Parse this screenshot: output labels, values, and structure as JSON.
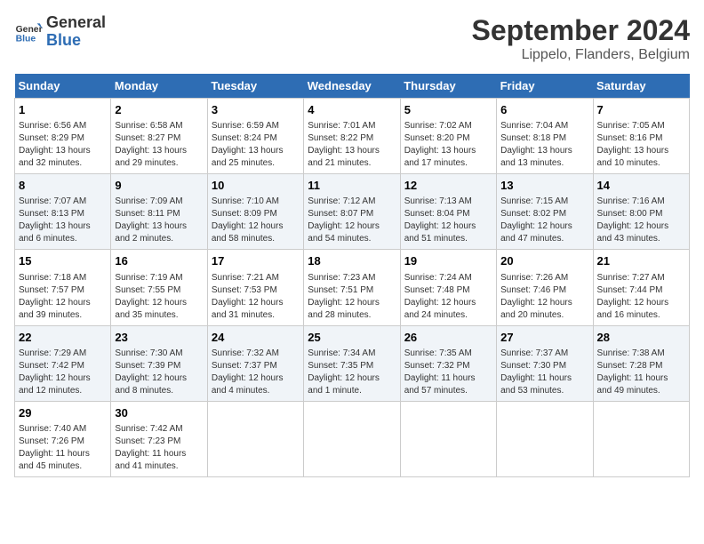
{
  "header": {
    "logo_line1": "General",
    "logo_line2": "Blue",
    "main_title": "September 2024",
    "subtitle": "Lippelo, Flanders, Belgium"
  },
  "days_of_week": [
    "Sunday",
    "Monday",
    "Tuesday",
    "Wednesday",
    "Thursday",
    "Friday",
    "Saturday"
  ],
  "weeks": [
    [
      {
        "day": "1",
        "info": "Sunrise: 6:56 AM\nSunset: 8:29 PM\nDaylight: 13 hours\nand 32 minutes."
      },
      {
        "day": "2",
        "info": "Sunrise: 6:58 AM\nSunset: 8:27 PM\nDaylight: 13 hours\nand 29 minutes."
      },
      {
        "day": "3",
        "info": "Sunrise: 6:59 AM\nSunset: 8:24 PM\nDaylight: 13 hours\nand 25 minutes."
      },
      {
        "day": "4",
        "info": "Sunrise: 7:01 AM\nSunset: 8:22 PM\nDaylight: 13 hours\nand 21 minutes."
      },
      {
        "day": "5",
        "info": "Sunrise: 7:02 AM\nSunset: 8:20 PM\nDaylight: 13 hours\nand 17 minutes."
      },
      {
        "day": "6",
        "info": "Sunrise: 7:04 AM\nSunset: 8:18 PM\nDaylight: 13 hours\nand 13 minutes."
      },
      {
        "day": "7",
        "info": "Sunrise: 7:05 AM\nSunset: 8:16 PM\nDaylight: 13 hours\nand 10 minutes."
      }
    ],
    [
      {
        "day": "8",
        "info": "Sunrise: 7:07 AM\nSunset: 8:13 PM\nDaylight: 13 hours\nand 6 minutes."
      },
      {
        "day": "9",
        "info": "Sunrise: 7:09 AM\nSunset: 8:11 PM\nDaylight: 13 hours\nand 2 minutes."
      },
      {
        "day": "10",
        "info": "Sunrise: 7:10 AM\nSunset: 8:09 PM\nDaylight: 12 hours\nand 58 minutes."
      },
      {
        "day": "11",
        "info": "Sunrise: 7:12 AM\nSunset: 8:07 PM\nDaylight: 12 hours\nand 54 minutes."
      },
      {
        "day": "12",
        "info": "Sunrise: 7:13 AM\nSunset: 8:04 PM\nDaylight: 12 hours\nand 51 minutes."
      },
      {
        "day": "13",
        "info": "Sunrise: 7:15 AM\nSunset: 8:02 PM\nDaylight: 12 hours\nand 47 minutes."
      },
      {
        "day": "14",
        "info": "Sunrise: 7:16 AM\nSunset: 8:00 PM\nDaylight: 12 hours\nand 43 minutes."
      }
    ],
    [
      {
        "day": "15",
        "info": "Sunrise: 7:18 AM\nSunset: 7:57 PM\nDaylight: 12 hours\nand 39 minutes."
      },
      {
        "day": "16",
        "info": "Sunrise: 7:19 AM\nSunset: 7:55 PM\nDaylight: 12 hours\nand 35 minutes."
      },
      {
        "day": "17",
        "info": "Sunrise: 7:21 AM\nSunset: 7:53 PM\nDaylight: 12 hours\nand 31 minutes."
      },
      {
        "day": "18",
        "info": "Sunrise: 7:23 AM\nSunset: 7:51 PM\nDaylight: 12 hours\nand 28 minutes."
      },
      {
        "day": "19",
        "info": "Sunrise: 7:24 AM\nSunset: 7:48 PM\nDaylight: 12 hours\nand 24 minutes."
      },
      {
        "day": "20",
        "info": "Sunrise: 7:26 AM\nSunset: 7:46 PM\nDaylight: 12 hours\nand 20 minutes."
      },
      {
        "day": "21",
        "info": "Sunrise: 7:27 AM\nSunset: 7:44 PM\nDaylight: 12 hours\nand 16 minutes."
      }
    ],
    [
      {
        "day": "22",
        "info": "Sunrise: 7:29 AM\nSunset: 7:42 PM\nDaylight: 12 hours\nand 12 minutes."
      },
      {
        "day": "23",
        "info": "Sunrise: 7:30 AM\nSunset: 7:39 PM\nDaylight: 12 hours\nand 8 minutes."
      },
      {
        "day": "24",
        "info": "Sunrise: 7:32 AM\nSunset: 7:37 PM\nDaylight: 12 hours\nand 4 minutes."
      },
      {
        "day": "25",
        "info": "Sunrise: 7:34 AM\nSunset: 7:35 PM\nDaylight: 12 hours\nand 1 minute."
      },
      {
        "day": "26",
        "info": "Sunrise: 7:35 AM\nSunset: 7:32 PM\nDaylight: 11 hours\nand 57 minutes."
      },
      {
        "day": "27",
        "info": "Sunrise: 7:37 AM\nSunset: 7:30 PM\nDaylight: 11 hours\nand 53 minutes."
      },
      {
        "day": "28",
        "info": "Sunrise: 7:38 AM\nSunset: 7:28 PM\nDaylight: 11 hours\nand 49 minutes."
      }
    ],
    [
      {
        "day": "29",
        "info": "Sunrise: 7:40 AM\nSunset: 7:26 PM\nDaylight: 11 hours\nand 45 minutes."
      },
      {
        "day": "30",
        "info": "Sunrise: 7:42 AM\nSunset: 7:23 PM\nDaylight: 11 hours\nand 41 minutes."
      },
      {
        "day": "",
        "info": ""
      },
      {
        "day": "",
        "info": ""
      },
      {
        "day": "",
        "info": ""
      },
      {
        "day": "",
        "info": ""
      },
      {
        "day": "",
        "info": ""
      }
    ]
  ]
}
